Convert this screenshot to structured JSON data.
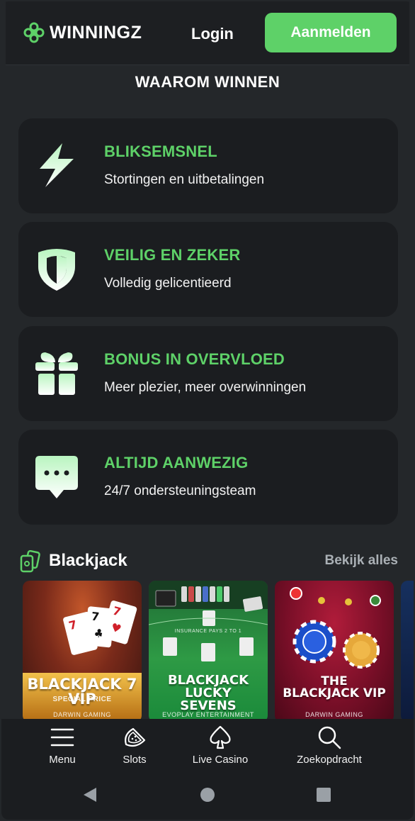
{
  "header": {
    "logo_text": "WINNINGZ",
    "login_label": "Login",
    "signup_label": "Aanmelden",
    "accent_color": "#5ed168"
  },
  "why": {
    "title": "WAAROM WINNEN",
    "features": [
      {
        "icon": "lightning-icon",
        "title": "BLIKSEMSNEL",
        "subtitle": "Stortingen en uitbetalingen"
      },
      {
        "icon": "shield-icon",
        "title": "VEILIG EN ZEKER",
        "subtitle": "Volledig gelicentieerd"
      },
      {
        "icon": "gift-icon",
        "title": "BONUS IN OVERVLOED",
        "subtitle": "Meer plezier, meer overwinningen"
      },
      {
        "icon": "chat-icon",
        "title": "ALTIJD AANWEZIG",
        "subtitle": "24/7 ondersteuningsteam"
      }
    ]
  },
  "blackjack": {
    "icon": "cards-icon",
    "title": "Blackjack",
    "view_all": "Bekijk alles",
    "games": [
      {
        "title": "BLACKJACK 7 VIP",
        "subtitle": "SPECIAL PRICE",
        "provider": "DARWIN GAMING"
      },
      {
        "title": "BLACKJACK LUCKY SEVENS",
        "subtitle": "INSURANCE PAYS 2 TO 1",
        "provider": "EVOPLAY ENTERTAINMENT"
      },
      {
        "title": "THE BLACKJACK VIP",
        "provider": "DARWIN GAMING"
      }
    ]
  },
  "bottom_nav": {
    "items": [
      {
        "icon": "menu-icon",
        "label": "Menu"
      },
      {
        "icon": "watermelon-icon",
        "label": "Slots"
      },
      {
        "icon": "spade-icon",
        "label": "Live Casino"
      },
      {
        "icon": "search-icon",
        "label": "Zoekopdracht"
      }
    ]
  }
}
